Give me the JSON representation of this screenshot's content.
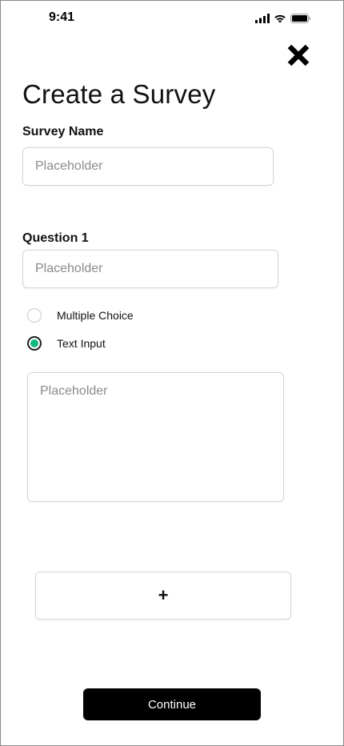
{
  "status_bar": {
    "time": "9:41",
    "icons": [
      "cellular-signal-icon",
      "wifi-icon",
      "battery-icon"
    ]
  },
  "header": {
    "close_icon": "close-icon",
    "title": "Create a Survey"
  },
  "form": {
    "survey_name": {
      "label": "Survey Name",
      "placeholder": "Placeholder",
      "value": ""
    },
    "question_1": {
      "label": "Question 1",
      "placeholder": "Placeholder",
      "value": ""
    },
    "answer_type": {
      "options": [
        {
          "label": "Multiple Choice",
          "selected": false
        },
        {
          "label": "Text Input",
          "selected": true
        }
      ],
      "selected": "Text Input"
    },
    "text_answer": {
      "placeholder": "Placeholder",
      "value": ""
    }
  },
  "add_question_button": {
    "label": "+"
  },
  "continue_button": {
    "label": "Continue"
  },
  "colors": {
    "accent": "#10b981",
    "primary_button": "#000000",
    "border": "#d6d6d6",
    "placeholder": "#8a8a8a"
  }
}
